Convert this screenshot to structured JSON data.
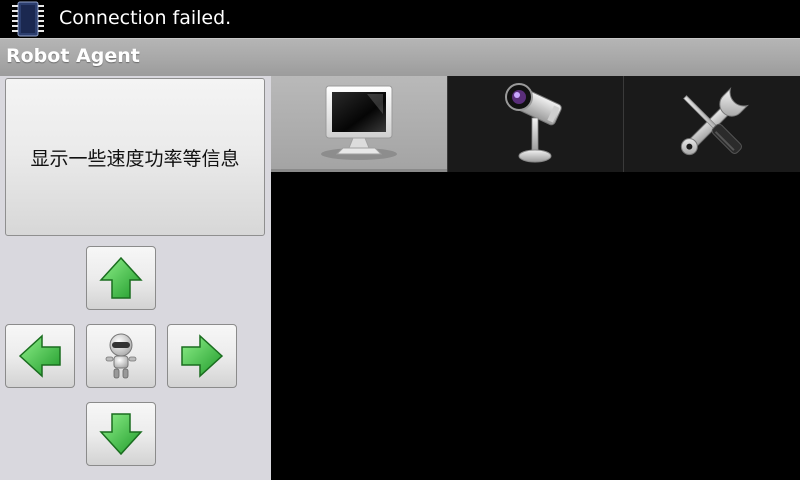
{
  "status_bar": {
    "message": "Connection failed.",
    "icon": "chip-icon"
  },
  "title_bar": {
    "title": "Robot Agent"
  },
  "info_panel": {
    "text": "显示一些速度功率等信息"
  },
  "dpad": {
    "up": "arrow-up-icon",
    "down": "arrow-down-icon",
    "left": "arrow-left-icon",
    "right": "arrow-right-icon",
    "center": "robot-icon"
  },
  "tabs": [
    {
      "icon": "monitor-icon",
      "selected": true
    },
    {
      "icon": "camera-icon",
      "selected": false
    },
    {
      "icon": "tools-icon",
      "selected": false
    }
  ],
  "colors": {
    "arrow_green": "#3cb43c",
    "panel_bg": "#d9d8de",
    "title_bar": "#a9a9a9"
  }
}
